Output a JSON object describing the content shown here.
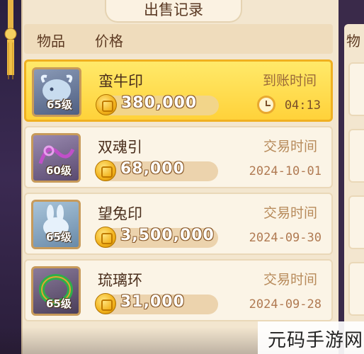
{
  "title": "出售记录",
  "header": {
    "col_item": "物品",
    "col_price": "价格",
    "right_col": "物"
  },
  "rows": [
    {
      "name": "蛮牛印",
      "level": "65级",
      "price": "380,000",
      "time_label": "到账时间",
      "time_value": "04:13",
      "selected": true,
      "icon": "bull-seal-icon"
    },
    {
      "name": "双魂引",
      "level": "60级",
      "price": "68,000",
      "time_label": "交易时间",
      "time_value": "2024-10-01",
      "selected": false,
      "icon": "soul-ribbon-icon"
    },
    {
      "name": "望兔印",
      "level": "65级",
      "price": "3,500,000",
      "time_label": "交易时间",
      "time_value": "2024-09-30",
      "selected": false,
      "icon": "rabbit-seal-icon"
    },
    {
      "name": "琉璃环",
      "level": "65级",
      "price": "31,000",
      "time_label": "交易时间",
      "time_value": "2024-09-28",
      "selected": false,
      "icon": "jade-ring-icon"
    }
  ],
  "watermark": "元码手游网",
  "colors": {
    "selected_bg": "#ffd23a",
    "panel_bg": "#f3e6cf",
    "coin": "#f2b21c"
  }
}
